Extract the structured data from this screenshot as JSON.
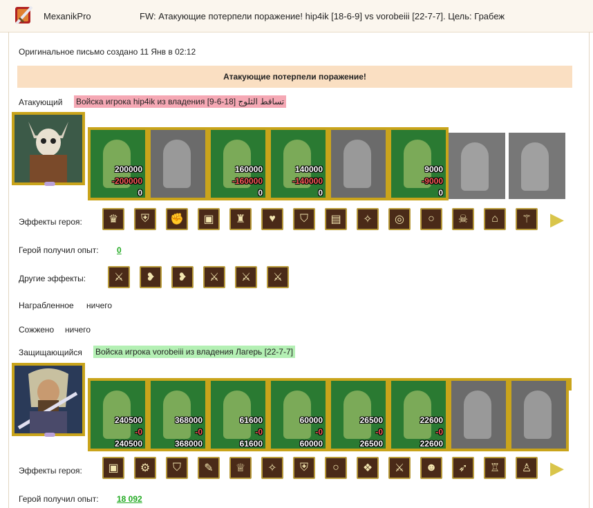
{
  "header": {
    "sender": "MexanikPro",
    "subject": "FW: Атакующие потерпели поражение! hip4ik [18-6-9] vs vorobeiii [22-7-7]. Цель: Грабеж",
    "logo_icon": "sword-shield-icon"
  },
  "created": "Оригинальное письмо создано 11 Янв в 02:12",
  "banner": "Атакующие потерпели поражение!",
  "attacker": {
    "label": "Атакующий",
    "army_title": "Войска игрока hip4ik из владения تساقط الثلوج [18-6-9]",
    "units": [
      {
        "state": "alive",
        "n1": "200000",
        "n2": "-200000",
        "n3": "0"
      },
      {
        "state": "dead",
        "n1": "",
        "n2": "",
        "n3": ""
      },
      {
        "state": "alive",
        "n1": "160000",
        "n2": "-160000",
        "n3": "0"
      },
      {
        "state": "alive",
        "n1": "140000",
        "n2": "-140000",
        "n3": "0"
      },
      {
        "state": "dead",
        "n1": "",
        "n2": "",
        "n3": ""
      },
      {
        "state": "alive",
        "n1": "9000",
        "n2": "-9000",
        "n3": "0"
      },
      {
        "state": "empty",
        "n1": "",
        "n2": "",
        "n3": ""
      },
      {
        "state": "empty",
        "n1": "",
        "n2": "",
        "n3": ""
      }
    ],
    "effects_label": "Эффекты героя:",
    "effects_icons": [
      "crown-icon",
      "armor-icon",
      "gauntlet-icon",
      "chest-icon",
      "castle-icon",
      "heart-icon",
      "shield-icon",
      "barrel-icon",
      "amulet-icon",
      "cylinder-icon",
      "ring-icon",
      "skull-ring-icon",
      "boot-icon",
      "staff-icon"
    ],
    "exp_label": "Герой получил опыт:",
    "exp_value": "0",
    "other_label": "Другие эффекты:",
    "other_icons": [
      "sword-icon",
      "hearts-icon",
      "hearts-icon",
      "sword-icon",
      "green-sword-icon",
      "sword-icon"
    ],
    "loot_label": "Награбленное",
    "loot_value": "ничего",
    "burned_label": "Сожжено",
    "burned_value": "ничего"
  },
  "defender": {
    "label": "Защищающийся",
    "army_title": "Войска игрока vorobeiii из владения Лагерь [22-7-7]",
    "units": [
      {
        "state": "alive",
        "n1": "240500",
        "n2": "-0",
        "n3": "240500"
      },
      {
        "state": "alive",
        "n1": "368000",
        "n2": "-0",
        "n3": "368000"
      },
      {
        "state": "alive",
        "n1": "61600",
        "n2": "-0",
        "n3": "61600"
      },
      {
        "state": "alive",
        "n1": "60000",
        "n2": "-0",
        "n3": "60000"
      },
      {
        "state": "alive",
        "n1": "26500",
        "n2": "-0",
        "n3": "26500"
      },
      {
        "state": "alive",
        "n1": "22600",
        "n2": "-0",
        "n3": "22600"
      },
      {
        "state": "dead",
        "n1": "",
        "n2": "",
        "n3": ""
      },
      {
        "state": "dead",
        "n1": "",
        "n2": "",
        "n3": ""
      }
    ],
    "effects_label": "Эффекты героя:",
    "effects_icons": [
      "chest-icon",
      "gear-icon",
      "shield-icon",
      "scroll-icon",
      "helmet-icon",
      "amulet-icon",
      "armor-icon",
      "ring-icon",
      "shell-icon",
      "sword-icon",
      "mask-icon",
      "arrow-icon",
      "tower-icon",
      "figure-icon"
    ],
    "exp_label": "Герой получил опыт:",
    "exp_value": "18 092"
  },
  "colors": {
    "loss": "#ff5a5a",
    "exp": "#22aa22",
    "attacker_tag": "#f5a8b4",
    "defender_tag": "#b4f0b4",
    "banner": "#fadfc2"
  }
}
